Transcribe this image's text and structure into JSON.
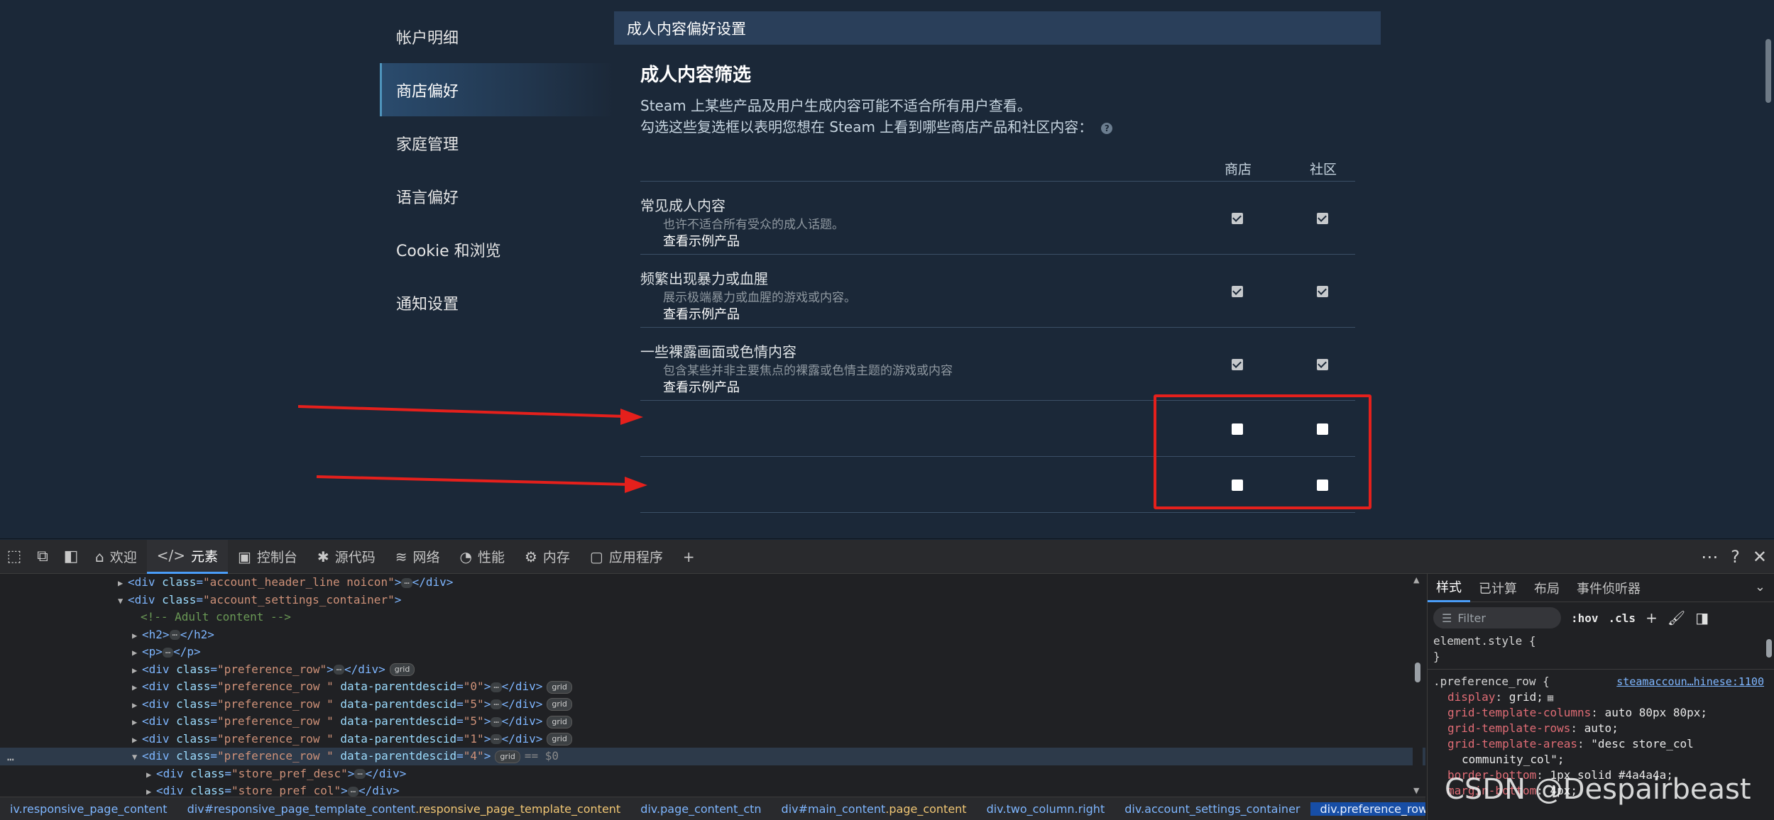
{
  "nav": {
    "items": [
      "帐户明细",
      "商店偏好",
      "家庭管理",
      "语言偏好",
      "Cookie 和浏览",
      "通知设置"
    ],
    "active_index": 1
  },
  "panel": {
    "header": "成人内容偏好设置",
    "title": "成人内容筛选",
    "intro_line1": "Steam 上某些产品及用户生成内容可能不适合所有用户查看。",
    "intro_line2": "勾选这些复选框以表明您想在 Steam 上看到哪些商店产品和社区内容：",
    "help_glyph": "?",
    "col_store": "商店",
    "col_community": "社区",
    "rows": [
      {
        "title": "常见成人内容",
        "desc": "也许不适合所有受众的成人话题。",
        "link": "查看示例产品",
        "store": true,
        "community": true
      },
      {
        "title": "频繁出现暴力或血腥",
        "desc": "展示极端暴力或血腥的游戏或内容。",
        "link": "查看示例产品",
        "store": true,
        "community": true
      },
      {
        "title": "一些裸露画面或色情内容",
        "desc": "包含某些并非主要焦点的裸露或色情主题的游戏或内容",
        "link": "查看示例产品",
        "store": true,
        "community": true
      },
      {
        "title": "",
        "desc": "",
        "link": "",
        "store": false,
        "community": false
      },
      {
        "title": "",
        "desc": "",
        "link": "",
        "store": false,
        "community": false
      }
    ]
  },
  "annotation": {
    "color": "#e5201c"
  },
  "devtools": {
    "tabs": [
      {
        "icon": "home-icon",
        "glyph": "⌂",
        "label": "欢迎"
      },
      {
        "icon": "code-icon",
        "glyph": "</>",
        "label": "元素"
      },
      {
        "icon": "console-icon",
        "glyph": "▣",
        "label": "控制台"
      },
      {
        "icon": "bug-icon",
        "glyph": "✱",
        "label": "源代码"
      },
      {
        "icon": "wifi-icon",
        "glyph": "≋",
        "label": "网络"
      },
      {
        "icon": "performance-icon",
        "glyph": "◔",
        "label": "性能"
      },
      {
        "icon": "memory-icon",
        "glyph": "⚙",
        "label": "内存"
      },
      {
        "icon": "application-icon",
        "glyph": "▢",
        "label": "应用程序"
      }
    ],
    "add_tab_glyph": "+",
    "right_tools": [
      "⋯",
      "?",
      "✕"
    ],
    "dom": {
      "l1": {
        "cls": "\"account_header_line noicon\""
      },
      "l2": {
        "cls": "\"account_settings_container\""
      },
      "comment": "<!-- Adult content -->",
      "h2": "<h2>",
      "h2_close": "</h2>",
      "p": "<p>",
      "p_close": "</p>",
      "pref0": "\"preference_row\"",
      "pref_rows": [
        {
          "cls": "\"preference_row  \"",
          "descid": "\"0\""
        },
        {
          "cls": "\"preference_row  \"",
          "descid": "\"5\""
        },
        {
          "cls": "\"preference_row  \"",
          "descid": "\"5\""
        },
        {
          "cls": "\"preference_row  \"",
          "descid": "\"1\""
        },
        {
          "cls": "\"preference_row  \"",
          "descid": "\"4\""
        }
      ],
      "child1": "\"store_pref_desc\"",
      "child2": "\"store_pref_col\"",
      "grid_badge": "grid",
      "eq0": "== $0",
      "ellipsis": "⋯",
      "dots": "⋯"
    },
    "breadcrumbs": [
      {
        "text": "iv.responsive_page_content"
      },
      {
        "tag": "div#responsive_page_template_content",
        "cls": ".responsive_page_template_content"
      },
      {
        "text": "div.page_content_ctn"
      },
      {
        "tag": "div#main_content",
        "cls": ".page_content"
      },
      {
        "text": "div.two_column.right"
      },
      {
        "text": "div.account_settings_container"
      },
      {
        "text": "div.preference_row."
      }
    ],
    "styles": {
      "tabs": [
        "样式",
        "已计算",
        "布局",
        "事件侦听器"
      ],
      "filter_placeholder": "Filter",
      "hov": ":hov",
      "cls": ".cls",
      "element_style": "element.style {",
      "close_brace": "}",
      "rule_selector": ".preference_row {",
      "rule_source": "steamaccoun…hinese:1100",
      "props": [
        {
          "name": "display",
          "value": "grid;"
        },
        {
          "name": "grid-template-columns",
          "value": "auto 80px 80px;"
        },
        {
          "name": "grid-template-rows",
          "value": "auto;"
        },
        {
          "name": "grid-template-areas",
          "value": "\"desc store_col"
        },
        {
          "name": "",
          "value": "community_col\";"
        },
        {
          "name": "border-bottom",
          "value": "1px solid #4a4a4a;"
        },
        {
          "name": "margin-bottom",
          "value": "4px;"
        }
      ]
    }
  },
  "watermark": "CSDN @Despairbeast"
}
